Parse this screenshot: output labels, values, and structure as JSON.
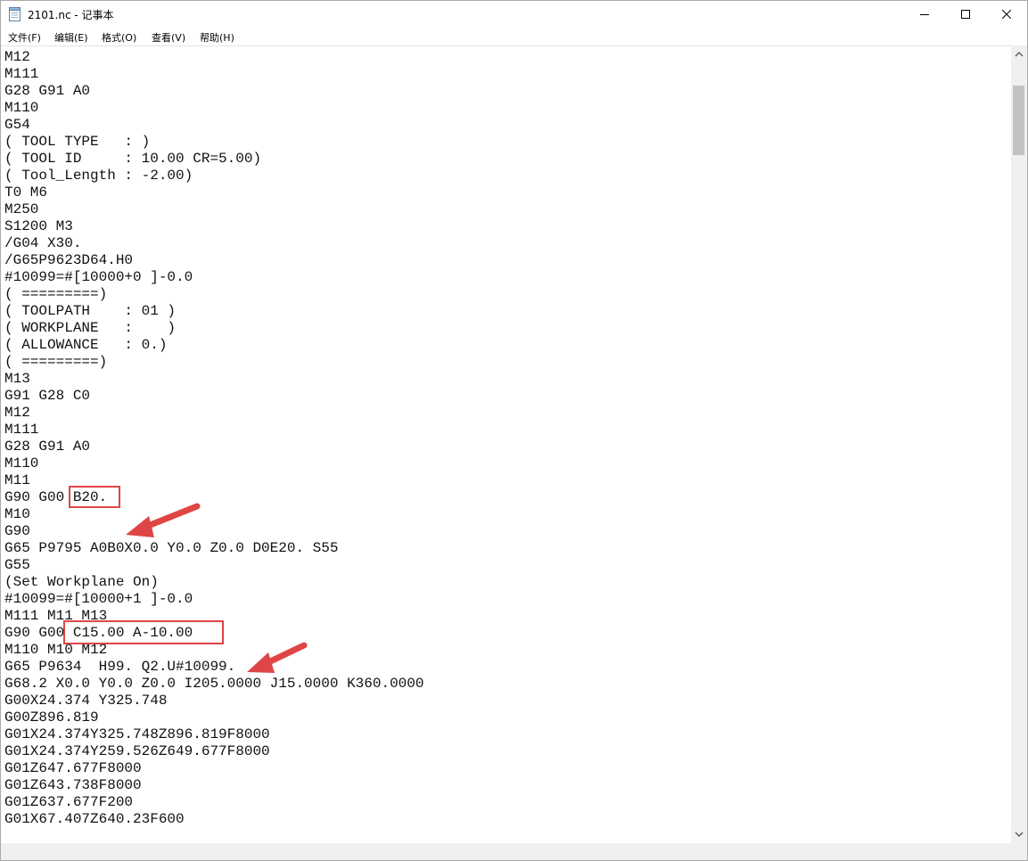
{
  "window": {
    "title": "2101.nc - 记事本",
    "icon": "notepad-icon",
    "controls": [
      "minimize-icon",
      "maximize-icon",
      "close-icon"
    ]
  },
  "menu": {
    "file": "文件(F)",
    "edit": "编辑(E)",
    "format": "格式(O)",
    "view": "查看(V)",
    "help": "帮助(H)"
  },
  "editor": {
    "lines": [
      "M12",
      "M111",
      "G28 G91 A0",
      "M110",
      "G54",
      "( TOOL TYPE   : )",
      "( TOOL ID     : 10.00 CR=5.00)",
      "( Tool_Length : -2.00)",
      "T0 M6",
      "M250",
      "S1200 M3",
      "/G04 X30.",
      "/G65P9623D64.H0",
      "#10099=#[10000+0 ]-0.0",
      "( =========)",
      "( TOOLPATH    : 01 )",
      "( WORKPLANE   :    )",
      "( ALLOWANCE   : 0.)",
      "( =========)",
      "M13",
      "G91 G28 C0",
      "M12",
      "M111",
      "G28 G91 A0",
      "M110",
      "M11",
      "G90 G00 B20.",
      "M10",
      "G90",
      "G65 P9795 A0B0X0.0 Y0.0 Z0.0 D0E20. S55",
      "G55",
      "(Set Workplane On)",
      "#10099=#[10000+1 ]-0.0",
      "M111 M11 M13",
      "G90 G00 C15.00 A-10.00",
      "M110 M10 M12",
      "G65 P9634  H99. Q2.U#10099.",
      "G68.2 X0.0 Y0.0 Z0.0 I205.0000 J15.0000 K360.0000",
      "G00X24.374 Y325.748",
      "G00Z896.819",
      "G01X24.374Y325.748Z896.819F8000",
      "G01X24.374Y259.526Z649.677F8000",
      "G01Z647.677F8000",
      "G01Z643.738F8000",
      "G01Z637.677F200",
      "G01X67.407Z640.23F600"
    ]
  },
  "annotations": {
    "color": "#e04545",
    "highlights": [
      "B20.",
      "C15.00 A-10.00"
    ]
  },
  "colors": {
    "text": "#111111",
    "scrollbar_track": "#f0f0f0",
    "scrollbar_thumb": "#c2c2c2"
  }
}
